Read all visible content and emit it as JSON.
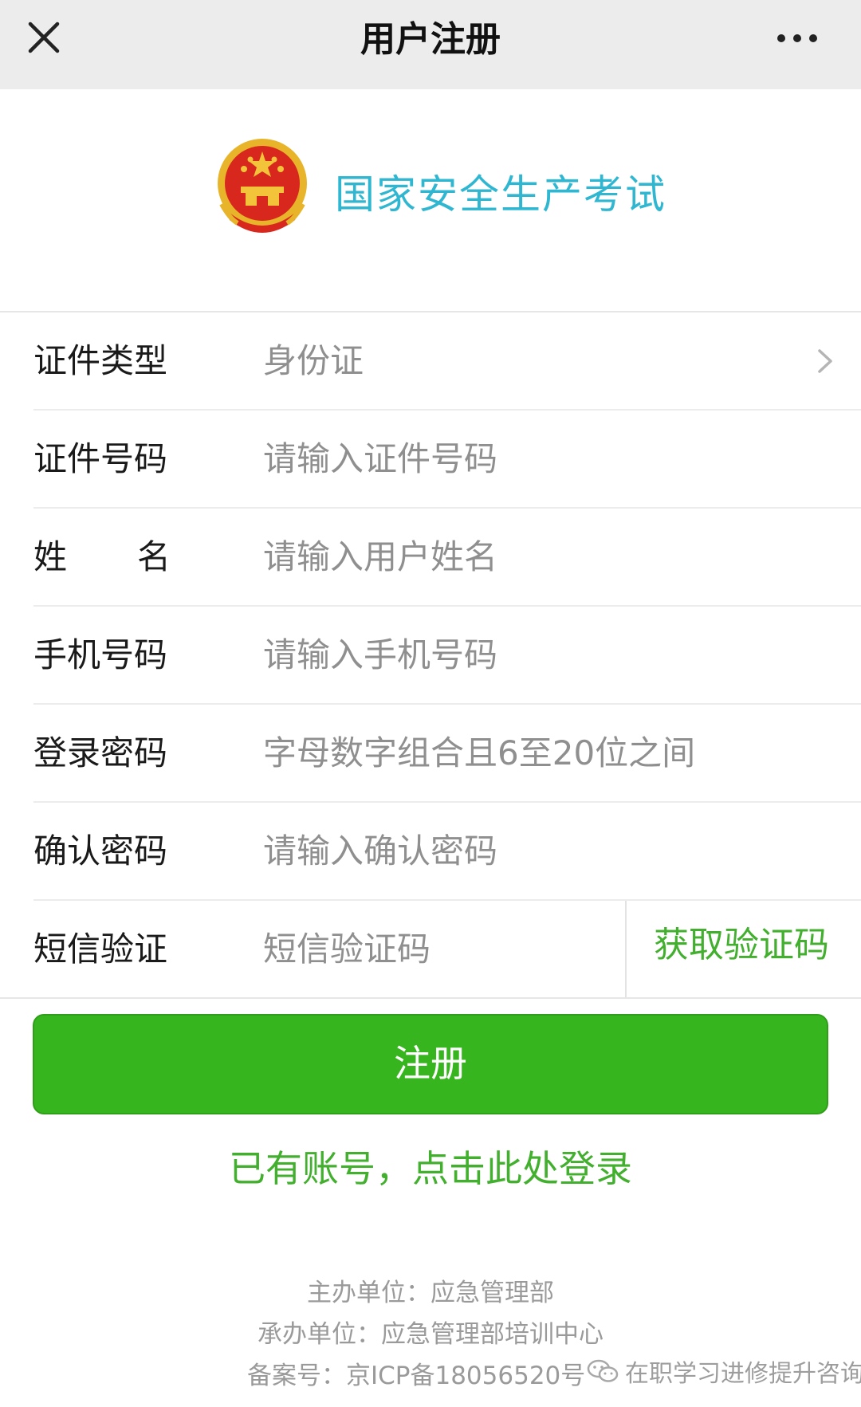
{
  "header": {
    "title": "用户注册",
    "close_icon": "close-icon",
    "more_icon": "more-dots-icon"
  },
  "brand": {
    "emblem_icon": "national-emblem-icon",
    "title": "国家安全生产考试",
    "color": "#2fb7d1"
  },
  "form": {
    "id_type": {
      "label": "证件类型",
      "value": "身份证"
    },
    "id_number": {
      "label": "证件号码",
      "placeholder": "请输入证件号码"
    },
    "name": {
      "label_first": "姓",
      "label_second": "名",
      "placeholder": "请输入用户姓名"
    },
    "phone": {
      "label": "手机号码",
      "placeholder": "请输入手机号码"
    },
    "password": {
      "label": "登录密码",
      "placeholder": "字母数字组合且6至20位之间"
    },
    "confirm_password": {
      "label": "确认密码",
      "placeholder": "请输入确认密码"
    },
    "sms": {
      "label": "短信验证",
      "placeholder": "短信验证码",
      "get_code": "获取验证码"
    }
  },
  "actions": {
    "register": "注册",
    "login_link": "已有账号，点击此处登录",
    "accent": "#37b51e"
  },
  "footer": {
    "host": "主办单位：应急管理部",
    "organizer": "承办单位：应急管理部培训中心",
    "icp": "备案号：京ICP备18056520号"
  },
  "watermark": {
    "text": "在职学习进修提升咨询",
    "icon": "wechat-icon"
  }
}
